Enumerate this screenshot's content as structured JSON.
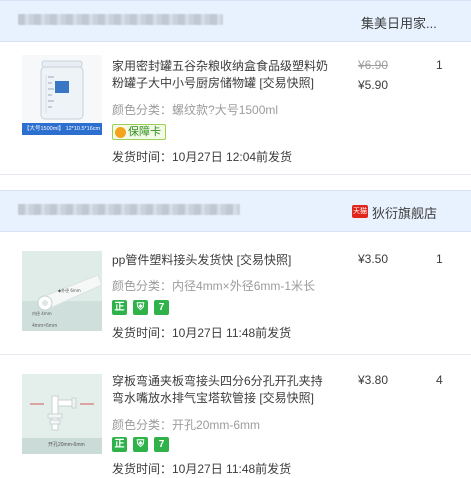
{
  "shops": [
    {
      "name": "集美日用家...",
      "items": [
        {
          "title": "家用密封罐五谷杂粮收纳盒食品级塑料奶粉罐子大中小号厨房储物罐 [交易快照]",
          "sku_label": "颜色分类：",
          "sku_value": "螺纹款?大号1500ml",
          "badge_text": "保障卡",
          "ship_time": "发货时间：10月27日 12:04前发货",
          "price_original": "¥6.90",
          "price": "¥5.90",
          "qty": "1",
          "thumb_caption": "【大号1500ml】 12*10.5*16cm"
        }
      ]
    },
    {
      "name": "狄衍旗舰店",
      "tmall_label": "天猫",
      "items": [
        {
          "title": "pp管件塑料接头发货快 [交易快照]",
          "sku_label": "颜色分类：",
          "sku_value": "内径4mm×外径6mm-1米长",
          "badges": [
            "正",
            "⛨",
            "7"
          ],
          "ship_time": "发货时间：10月27日 11:48前发货",
          "price": "¥3.50",
          "qty": "1",
          "thumb_caption": "4mm×6mm"
        },
        {
          "title": "穿板弯通夹板弯接头四分6分孔开孔夹持弯水嘴放水排气宝塔软管接 [交易快照]",
          "sku_label": "颜色分类：",
          "sku_value": "开孔20mm-6mm",
          "badges": [
            "正",
            "⛨",
            "7"
          ],
          "ship_time": "发货时间：10月27日 11:48前发货",
          "price": "¥3.80",
          "qty": "4",
          "thumb_caption": "开孔20mm-6mm"
        }
      ]
    }
  ],
  "colors": {
    "header_bg": "#e8f2ff",
    "badge_green": "#2fb24a",
    "tmall_red": "#e1251b"
  }
}
